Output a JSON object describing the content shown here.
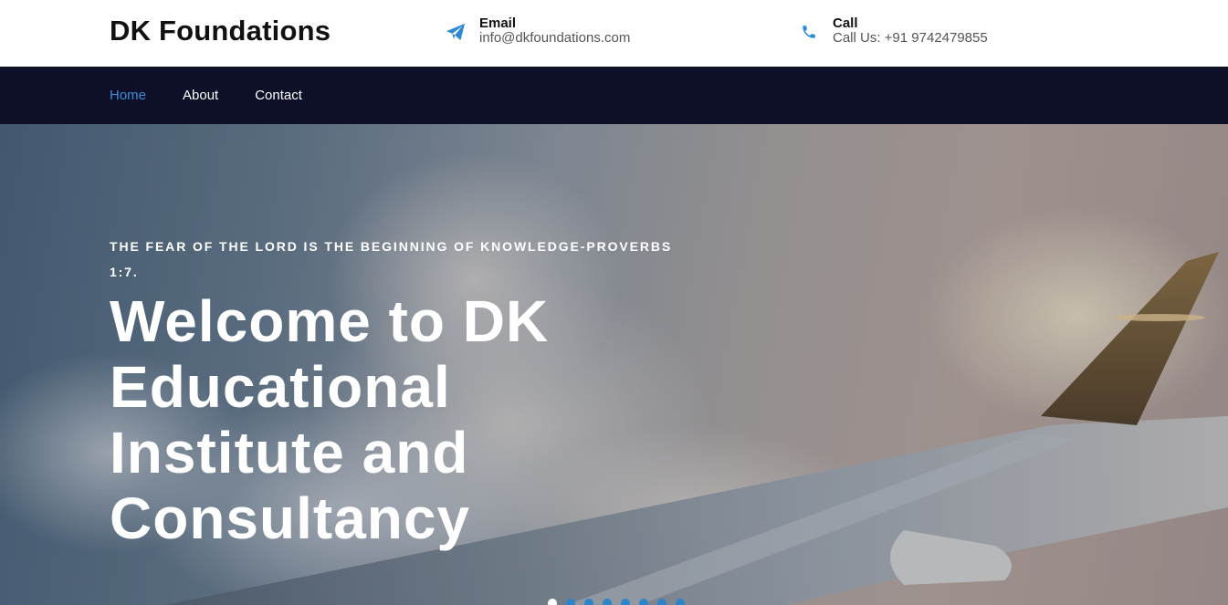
{
  "header": {
    "brand": "DK Foundations",
    "email": {
      "title": "Email",
      "value": "info@dkfoundations.com",
      "icon": "paper-plane-icon"
    },
    "call": {
      "title": "Call",
      "value": "Call Us: +91 9742479855",
      "icon": "phone-icon"
    }
  },
  "nav": {
    "items": [
      {
        "label": "Home",
        "active": true
      },
      {
        "label": "About",
        "active": false
      },
      {
        "label": "Contact",
        "active": false
      }
    ]
  },
  "hero": {
    "tagline": "THE FEAR OF THE LORD IS THE BEGINNING OF KNOWLEDGE-PROVERBS 1:7.",
    "headline": "Welcome to DK Educational Institute and Consultancy",
    "slides": {
      "count": 8,
      "active_index": 0
    }
  },
  "colors": {
    "navbar_bg": "#0e0f28",
    "accent": "#3b8fd9",
    "text_dark": "#111111"
  }
}
